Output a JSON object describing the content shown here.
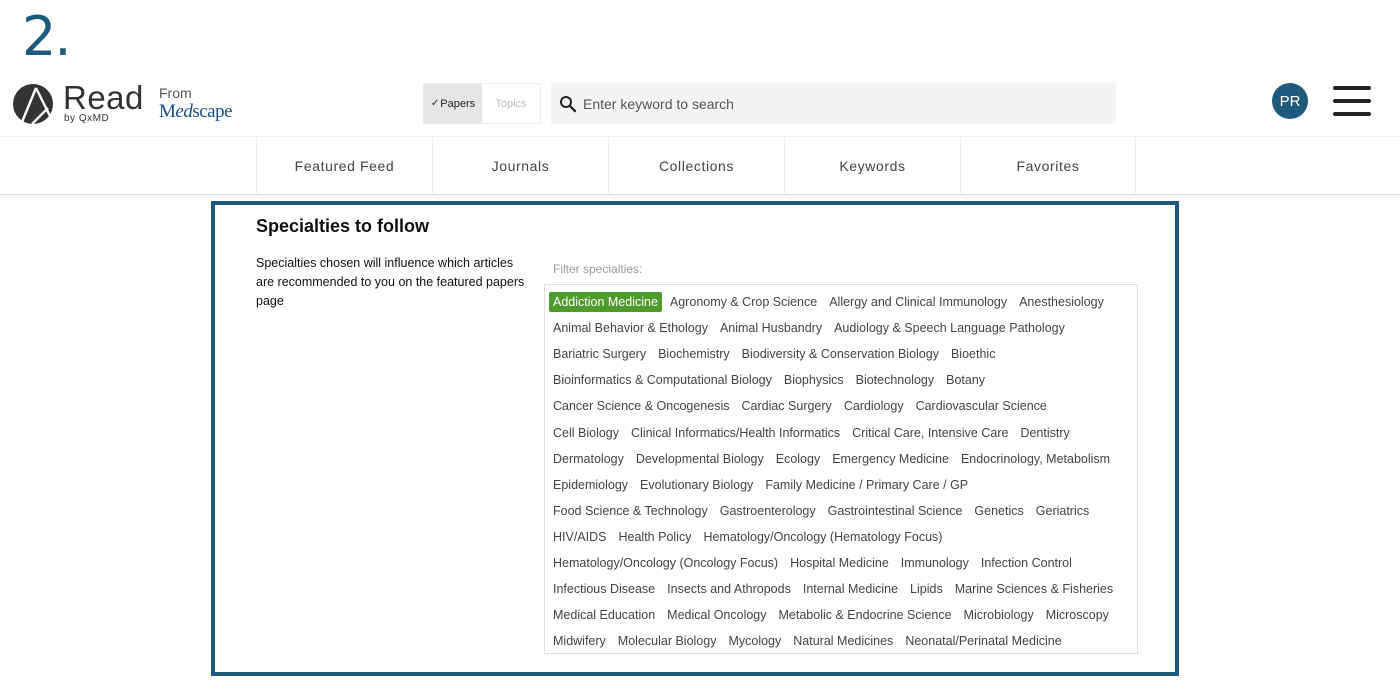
{
  "step_number": "2.",
  "logo": {
    "brand": "Read",
    "byline": "by QxMD",
    "from": "From",
    "partner": "Medscape"
  },
  "toggle": {
    "papers": "Papers",
    "topics": "Topics",
    "active": "papers"
  },
  "search": {
    "placeholder": "Enter keyword to search"
  },
  "user": {
    "initials": "PR"
  },
  "nav": [
    "Featured Feed",
    "Journals",
    "Collections",
    "Keywords",
    "Favorites"
  ],
  "panel": {
    "title": "Specialties to follow",
    "description": "Specialties chosen will influence which articles are recommended to you on the featured papers page",
    "filter_label": "Filter specialties:",
    "selected_color": "#4e9a2a",
    "rows": [
      [
        {
          "label": "Addiction Medicine",
          "selected": true
        },
        {
          "label": "Agronomy & Crop Science"
        },
        {
          "label": "Allergy and Clinical Immunology"
        },
        {
          "label": "Anesthesiology"
        }
      ],
      [
        {
          "label": "Animal Behavior & Ethology"
        },
        {
          "label": "Animal Husbandry"
        },
        {
          "label": "Audiology & Speech Language Pathology"
        }
      ],
      [
        {
          "label": "Bariatric Surgery"
        },
        {
          "label": "Biochemistry"
        },
        {
          "label": "Biodiversity & Conservation Biology"
        },
        {
          "label": "Bioethic"
        }
      ],
      [
        {
          "label": "Bioinformatics & Computational Biology"
        },
        {
          "label": "Biophysics"
        },
        {
          "label": "Biotechnology"
        },
        {
          "label": "Botany"
        }
      ],
      [
        {
          "label": "Cancer Science & Oncogenesis"
        },
        {
          "label": "Cardiac Surgery"
        },
        {
          "label": "Cardiology"
        },
        {
          "label": "Cardiovascular Science"
        }
      ],
      [
        {
          "label": "Cell Biology"
        },
        {
          "label": "Clinical Informatics/Health Informatics"
        },
        {
          "label": "Critical Care, Intensive Care"
        },
        {
          "label": "Dentistry"
        }
      ],
      [
        {
          "label": "Dermatology"
        },
        {
          "label": "Developmental Biology"
        },
        {
          "label": "Ecology"
        },
        {
          "label": "Emergency Medicine"
        },
        {
          "label": "Endocrinology, Metabolism"
        }
      ],
      [
        {
          "label": "Epidemiology"
        },
        {
          "label": "Evolutionary Biology"
        },
        {
          "label": "Family Medicine / Primary Care / GP"
        }
      ],
      [
        {
          "label": "Food Science & Technology"
        },
        {
          "label": "Gastroenterology"
        },
        {
          "label": "Gastrointestinal Science"
        },
        {
          "label": "Genetics"
        },
        {
          "label": "Geriatrics"
        }
      ],
      [
        {
          "label": "HIV/AIDS"
        },
        {
          "label": "Health Policy"
        },
        {
          "label": "Hematology/Oncology (Hematology Focus)"
        }
      ],
      [
        {
          "label": "Hematology/Oncology (Oncology Focus)"
        },
        {
          "label": "Hospital Medicine"
        },
        {
          "label": "Immunology"
        },
        {
          "label": "Infection Control"
        }
      ],
      [
        {
          "label": "Infectious Disease"
        },
        {
          "label": "Insects and Athropods"
        },
        {
          "label": "Internal Medicine"
        },
        {
          "label": "Lipids"
        },
        {
          "label": "Marine Sciences & Fisheries"
        }
      ],
      [
        {
          "label": "Medical Education"
        },
        {
          "label": "Medical Oncology"
        },
        {
          "label": "Metabolic & Endocrine Science"
        },
        {
          "label": "Microbiology"
        },
        {
          "label": "Microscopy"
        }
      ],
      [
        {
          "label": "Midwifery"
        },
        {
          "label": "Molecular Biology"
        },
        {
          "label": "Mycology"
        },
        {
          "label": "Natural Medicines"
        },
        {
          "label": "Neonatal/Perinatal Medicine"
        }
      ]
    ]
  }
}
